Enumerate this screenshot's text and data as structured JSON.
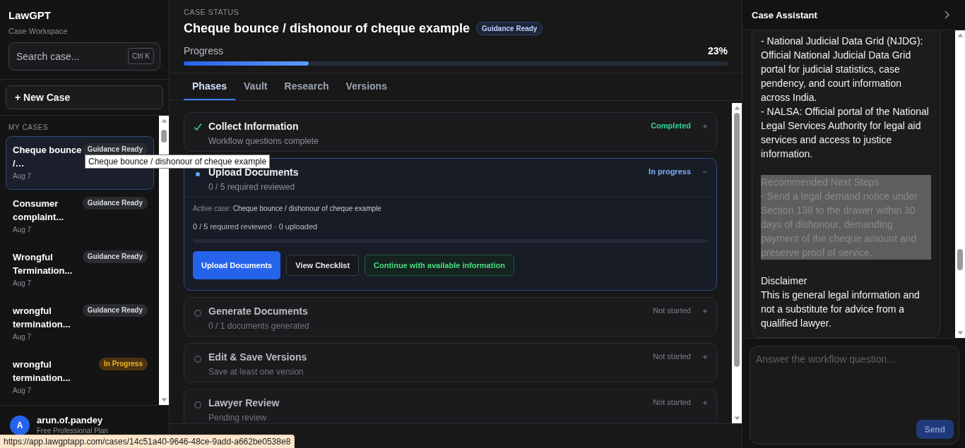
{
  "sidebar": {
    "brand": "LawGPT",
    "subtitle": "Case Workspace",
    "search": {
      "placeholder": "Search case...",
      "shortcut": "Ctrl K"
    },
    "new_case": "+ New Case",
    "section_label": "MY CASES",
    "cases": [
      {
        "title": "Cheque bounce /…",
        "date": "Aug 7",
        "badge": "Guidance Ready",
        "kind": "ready",
        "selected": true
      },
      {
        "title": "Consumer complaint...",
        "date": "Aug 7",
        "badge": "Guidance Ready",
        "kind": "ready",
        "selected": false
      },
      {
        "title": "Wrongful Termination...",
        "date": "Aug 7",
        "badge": "Guidance Ready",
        "kind": "ready",
        "selected": false
      },
      {
        "title": "wrongful termination...",
        "date": "Aug 7",
        "badge": "Guidance Ready",
        "kind": "ready",
        "selected": false
      },
      {
        "title": "wrongful termination...",
        "date": "Aug 7",
        "badge": "In Progress",
        "kind": "progress",
        "selected": false
      }
    ],
    "user": {
      "avatar": "A",
      "name": "arun.of.pandey",
      "plan": "Free Professional Plan"
    }
  },
  "main": {
    "eyebrow": "CASE STATUS",
    "title": "Cheque bounce / dishonour of cheque example",
    "badge": "Guidance Ready",
    "progress": {
      "label": "Progress",
      "reading": "23%",
      "level": 0.23
    },
    "tabs": [
      {
        "label": "Phases",
        "selected": true
      },
      {
        "label": "Vault",
        "selected": false
      },
      {
        "label": "Research",
        "selected": false
      },
      {
        "label": "Versions",
        "selected": false
      }
    ],
    "phases": [
      {
        "title": "Collect Information",
        "subtitle": "Workflow questions complete",
        "status": "Completed",
        "kind": "completed",
        "expanded": false
      },
      {
        "title": "Upload Documents",
        "subtitle": "0 / 5 required reviewed",
        "status": "In progress",
        "kind": "in_progress",
        "expanded": true,
        "details": {
          "active_label": "Active case:",
          "active_value": "Cheque bounce / dishonour of cheque example",
          "summary": "0 / 5 required reviewed · 0 uploaded",
          "buttons": [
            {
              "label": "Upload Documents",
              "kind": "primary"
            },
            {
              "label": "View Checklist",
              "kind": "secondary"
            },
            {
              "label": "Continue with available information",
              "kind": "success"
            }
          ]
        }
      },
      {
        "title": "Generate Documents",
        "subtitle": "0 / 1 documents generated",
        "status": "Not started",
        "kind": "not_started",
        "expanded": false
      },
      {
        "title": "Edit & Save Versions",
        "subtitle": "Save at least one version",
        "status": "Not started",
        "kind": "not_started",
        "expanded": false
      },
      {
        "title": "Lawyer Review",
        "subtitle": "Pending review",
        "status": "Not started",
        "kind": "not_started",
        "expanded": false
      }
    ]
  },
  "assistant": {
    "title": "Case Assistant",
    "message": [
      {
        "selected": false,
        "lines": [
          "- National Judicial Data Grid (NJDG): Official National Judicial Data Grid portal for judicial statistics, case pendency, and court information across India.",
          "- NALSA: Official portal of the National Legal Services Authority for legal aid services and access to justice information."
        ]
      },
      {
        "selected": true,
        "lines": [
          "Recommended Next Steps",
          "- Send a legal demand notice under Section 138 to the drawer within 30 days of dishonour, demanding payment of the cheque amount and preserve proof of service."
        ]
      },
      {
        "selected": false,
        "lines": [
          "Disclaimer",
          "This is general legal information and not a substitute for advice from a qualified lawyer."
        ]
      }
    ],
    "input": {
      "placeholder": "Answer the workflow question..."
    },
    "send": {
      "label": "Send",
      "disabled": true
    }
  },
  "tooltip": "Cheque bounce / dishonour of cheque example",
  "status_url": "https://app.lawgptapp.com/cases/14c51a40-9646-48ce-9add-a662be0538e8"
}
